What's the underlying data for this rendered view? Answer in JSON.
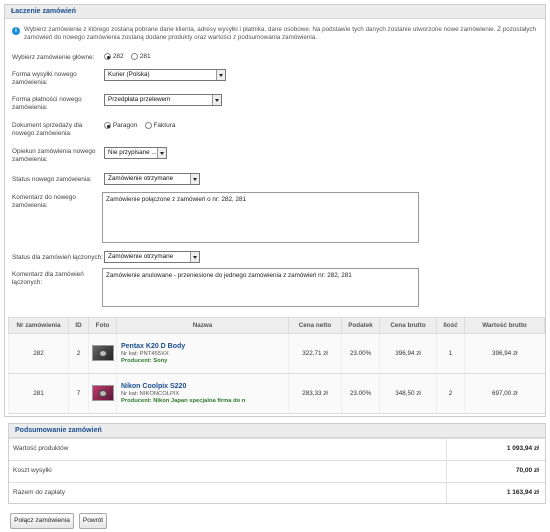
{
  "panel_title": "Łaczenie zamówień",
  "info_text": "Wybierz zamówienie z którego zostaną pobrane dane klienta, adresy wysyłki i płatnika, dane osobowe. Na podstawie tych danych zostanie utworzone nowe zamówienie. Z pozostałych zamówień do nowego zamówienia zostaną dodane produkty oraz wartości z podsumowania zamówienia.",
  "form": {
    "main_order_label": "Wybierz zamówienie główne:",
    "main_order_options": [
      "282",
      "281"
    ],
    "main_order_selected": "282",
    "shipping_label": "Forma wysyłki nowego zamówienia:",
    "shipping_value": "Kurier (Polska)",
    "payment_label": "Forma płatności nowego zamówienia:",
    "payment_value": "Przedpłata przelewem",
    "document_label": "Dokument sprzedaży dla nowego zamówienia:",
    "document_options": [
      "Paragon",
      "Faktura"
    ],
    "document_selected": "Paragon",
    "caretaker_label": "Opiekun zamówienia nowego zamówienia:",
    "caretaker_value": "Nie przypisane ...",
    "status_new_label": "Status nowego zamówienia:",
    "status_new_value": "Zamówienie otrzymane",
    "comment_new_label": "Komentarz do nowego zamówienia:",
    "comment_new_value": "Zamówienie połączone z zamówień o nr: 282, 281",
    "status_merged_label": "Status dla zamówień łączonych:",
    "status_merged_value": "Zamówienie otrzymane",
    "comment_merged_label": "Komentarz dla zamówień łączonych:",
    "comment_merged_value": "Zamówienie anulowane - przeniesione do jednego zamówienia z zamówień nr: 282, 281"
  },
  "table": {
    "headers": [
      "Nr zamówienia",
      "ID",
      "Foto",
      "Nazwa",
      "Cena netto",
      "Podatek",
      "Cena brutto",
      "Ilość",
      "Wartość brutto"
    ],
    "rows": [
      {
        "order": "282",
        "id": "2",
        "name": "Pentax K20 D Body",
        "sku": "Nr kat: PNT455XX",
        "producer": "Producent: Sony",
        "net": "322,71 zł",
        "tax": "23.00%",
        "gross": "396,94 zł",
        "qty": "1",
        "total": "396,94 zł"
      },
      {
        "order": "281",
        "id": "7",
        "name": "Nikon Coolpix S220",
        "sku": "Nr kat: NIKONCOLPIX",
        "producer": "Producent: Nikon Japan specjalna firma do n",
        "net": "283,33 zł",
        "tax": "23.00%",
        "gross": "348,50 zł",
        "qty": "2",
        "total": "697,00 zł"
      }
    ]
  },
  "summary": {
    "title": "Podsumowanie zamówień",
    "products_label": "Wartość produktów",
    "products_value": "1 093,94 zł",
    "shipping_label": "Koszt wysyłki",
    "shipping_value": "70,00 zł",
    "total_label": "Razem do zapłaty",
    "total_value": "1 163,94 zł"
  },
  "buttons": {
    "merge": "Połącz zamówienia",
    "back": "Powrót"
  }
}
